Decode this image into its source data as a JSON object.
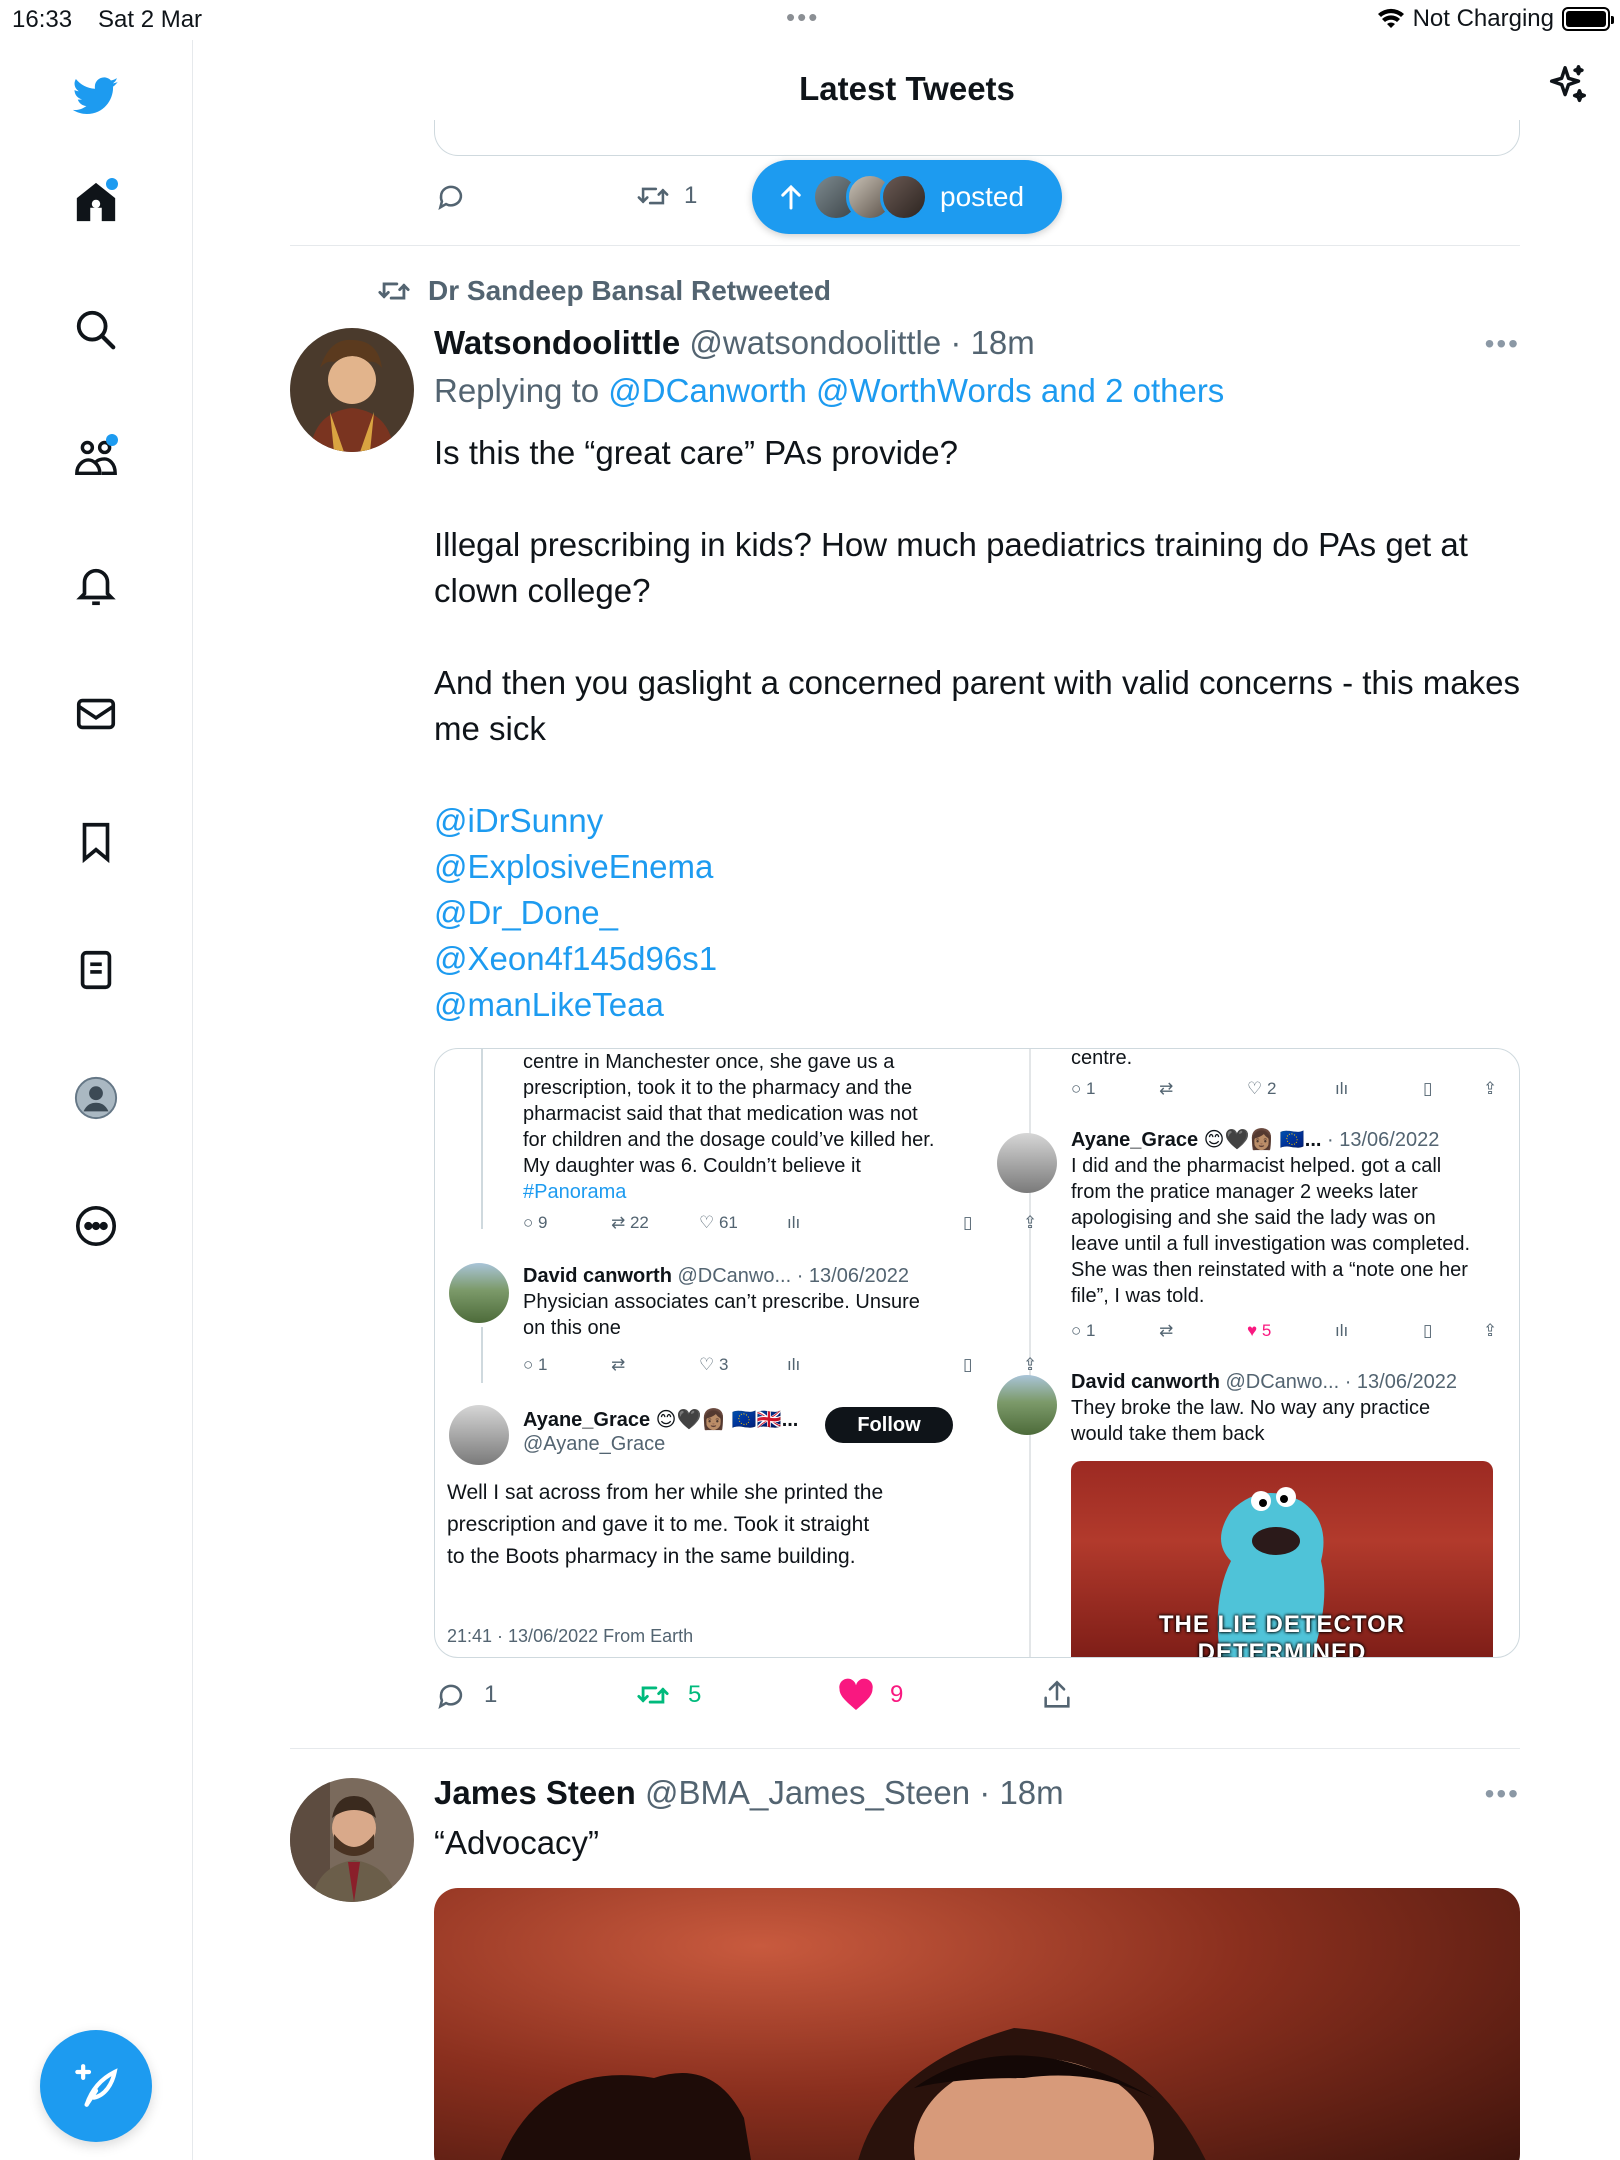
{
  "status_bar": {
    "time": "16:33",
    "date": "Sat 2 Mar",
    "charging": "Not Charging"
  },
  "header": {
    "title": "Latest Tweets"
  },
  "prev_tweet": {
    "retweet_count": "1"
  },
  "new_posts_pill": {
    "label": "posted"
  },
  "tweet1": {
    "retweeted_by": "Dr Sandeep Bansal Retweeted",
    "name": "Watsondoolittle",
    "handle": "@watsondoolittle",
    "time": "· 18m",
    "replying_label": "Replying to",
    "replying_to": "@DCanworth @WorthWords and 2 others",
    "text": "Is this the “great care” PAs provide?\n\nIllegal prescribing in kids? How much paediatrics training do PAs get at clown college?\n\nAnd then you gaslight a concerned parent with valid concerns - this makes me sick",
    "mentions": [
      "@iDrSunny",
      "@ExplosiveEnema",
      "@Dr_Done_",
      "@Xeon4f145d96s1",
      "@manLikeTeaa"
    ],
    "replies": "1",
    "retweets": "5",
    "likes": "9"
  },
  "embed": {
    "left": {
      "top_text": "centre in Manchester once, she gave us a\nprescription, took it to the pharmacy and the\npharmacist said that that medication was not\nfor children and the dosage could’ve killed her.\nMy daughter was 6. Couldn’t believe it",
      "hashtag": "#Panorama",
      "row1": {
        "replies": "9",
        "retweets": "22",
        "likes": "61"
      },
      "reply1_name": "David canworth",
      "reply1_meta": "@DCanwo... · 13/06/2022",
      "reply1_text": "Physician associates can’t prescribe. Unsure\non this one",
      "row2": {
        "replies": "1",
        "likes": "3"
      },
      "main_name": "Ayane_Grace 😊🖤👩🏽 🇪🇺🇬🇧...",
      "main_handle": "@Ayane_Grace",
      "follow_label": "Follow",
      "main_text": "Well I sat across from her while she printed the\nprescription and gave it to me. Took it straight\nto the Boots pharmacy in the same building.",
      "main_meta": "21:41 · 13/06/2022 From Earth"
    },
    "right": {
      "top_text": "centre.",
      "row1": {
        "replies": "1",
        "likes": "2"
      },
      "reply_name": "Ayane_Grace 😊🖤👩🏽 🇪🇺...",
      "reply_meta": "· 13/06/2022",
      "reply_text": "I did and the pharmacist helped. got a call\nfrom the pratice manager 2 weeks later\napologising and she said the lady was on\nleave until a full investigation was completed.\nShe was then reinstated with a “note one her\nfile”, I was told.",
      "row2": {
        "replies": "1",
        "likes": "5"
      },
      "reply2_name": "David canworth",
      "reply2_meta": "@DCanwo... · 13/06/2022",
      "reply2_text": "They broke the law. No way any practice\nwould take them back",
      "gif_caption": "THE LIE DETECTOR DETERMINED"
    }
  },
  "tweet2": {
    "name": "James Steen",
    "handle": "@BMA_James_Steen",
    "time": "· 18m",
    "text": "“Advocacy”"
  },
  "colors": {
    "accent": "#1d9bf0",
    "retweet": "#00ba7c",
    "like": "#f91880",
    "secondary": "#536471"
  }
}
